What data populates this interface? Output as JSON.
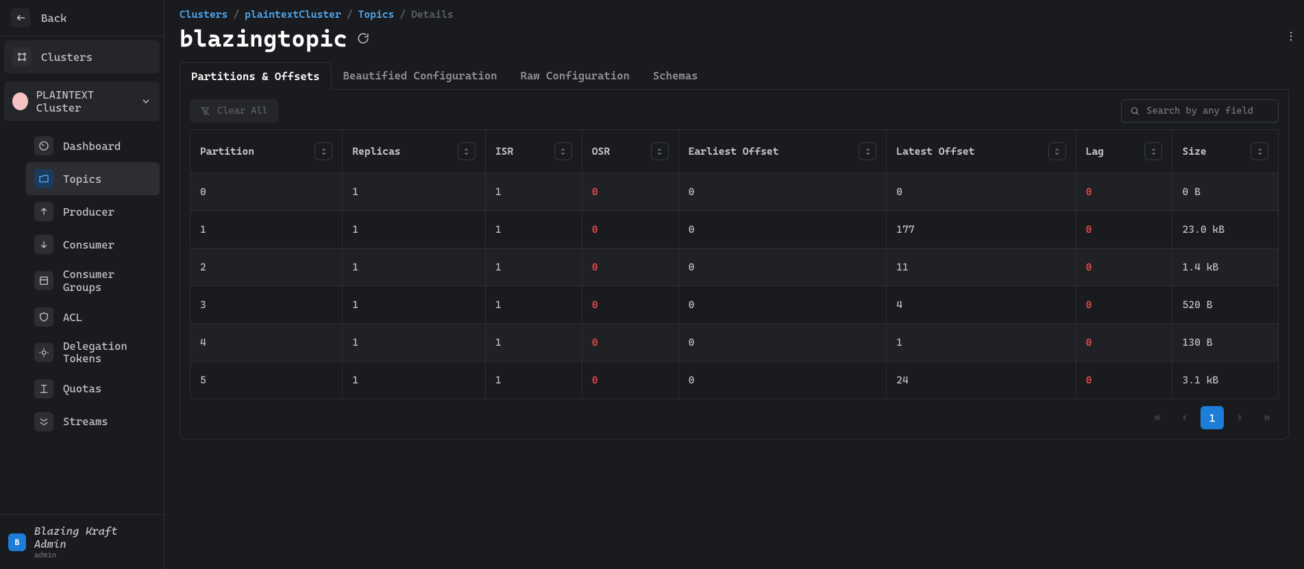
{
  "sidebar": {
    "back_label": "Back",
    "clusters_label": "Clusters",
    "cluster_name": "PLAINTEXT Cluster",
    "items": [
      {
        "label": "Dashboard"
      },
      {
        "label": "Topics"
      },
      {
        "label": "Producer"
      },
      {
        "label": "Consumer"
      },
      {
        "label": "Consumer Groups"
      },
      {
        "label": "ACL"
      },
      {
        "label": "Delegation Tokens"
      },
      {
        "label": "Quotas"
      },
      {
        "label": "Streams"
      }
    ],
    "user": {
      "badge": "B",
      "name": "Blazing Kraft Admin",
      "sub": "admin"
    }
  },
  "breadcrumbs": {
    "a": "Clusters",
    "b": "plaintextCluster",
    "c": "Topics",
    "d": "Details"
  },
  "page_title": "blazingtopic",
  "tabs": [
    {
      "label": "Partitions & Offsets"
    },
    {
      "label": "Beautified Configuration"
    },
    {
      "label": "Raw Configuration"
    },
    {
      "label": "Schemas"
    }
  ],
  "toolbar": {
    "clear_label": "Clear All",
    "search_placeholder": "Search by any field"
  },
  "columns": [
    "Partition",
    "Replicas",
    "ISR",
    "OSR",
    "Earliest Offset",
    "Latest Offset",
    "Lag",
    "Size"
  ],
  "rows": [
    {
      "partition": "0",
      "replicas": "1",
      "isr": "1",
      "osr": "0",
      "earliest": "0",
      "latest": "0",
      "lag": "0",
      "size": "0 B"
    },
    {
      "partition": "1",
      "replicas": "1",
      "isr": "1",
      "osr": "0",
      "earliest": "0",
      "latest": "177",
      "lag": "0",
      "size": "23.0 kB"
    },
    {
      "partition": "2",
      "replicas": "1",
      "isr": "1",
      "osr": "0",
      "earliest": "0",
      "latest": "11",
      "lag": "0",
      "size": "1.4 kB"
    },
    {
      "partition": "3",
      "replicas": "1",
      "isr": "1",
      "osr": "0",
      "earliest": "0",
      "latest": "4",
      "lag": "0",
      "size": "520 B"
    },
    {
      "partition": "4",
      "replicas": "1",
      "isr": "1",
      "osr": "0",
      "earliest": "0",
      "latest": "1",
      "lag": "0",
      "size": "130 B"
    },
    {
      "partition": "5",
      "replicas": "1",
      "isr": "1",
      "osr": "0",
      "earliest": "0",
      "latest": "24",
      "lag": "0",
      "size": "3.1 kB"
    }
  ],
  "pager": {
    "current": "1"
  }
}
